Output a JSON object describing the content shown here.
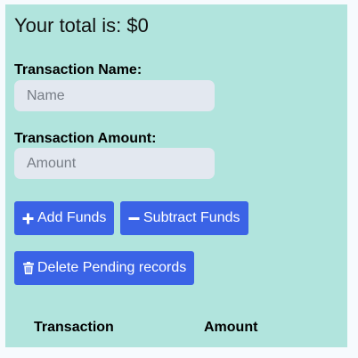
{
  "total": {
    "prefix": "Your total is: ",
    "amount": "$0"
  },
  "form": {
    "name_label": "Transaction Name:",
    "name_placeholder": "Name",
    "amount_label": "Transaction Amount:",
    "amount_placeholder": "Amount"
  },
  "buttons": {
    "add_label": "Add Funds",
    "add_icon": "plus-icon",
    "subtract_label": "Subtract Funds",
    "subtract_icon": "minus-icon",
    "delete_label": "Delete Pending records",
    "delete_icon": "trash-icon"
  },
  "table": {
    "headers": [
      "Transaction",
      "Amount"
    ]
  },
  "colors": {
    "panel_background": "#b1e4dd",
    "button_background": "#3a63e6",
    "input_background": "#e3e8f0"
  }
}
